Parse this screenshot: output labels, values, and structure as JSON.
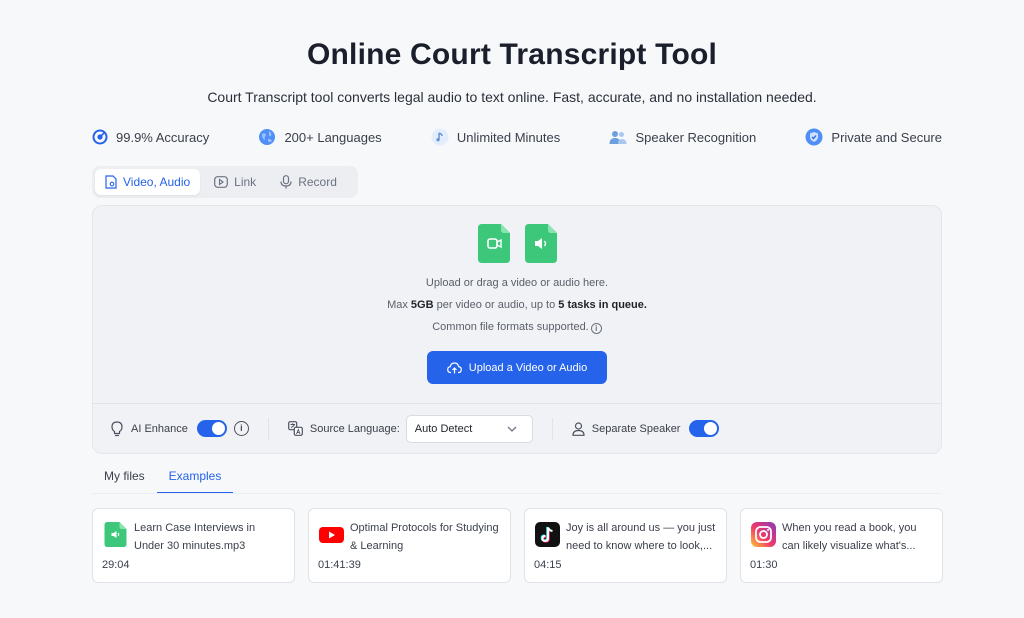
{
  "header": {
    "title": "Online Court Transcript Tool",
    "subtitle": "Court Transcript tool converts legal audio to text online. Fast, accurate, and no installation needed."
  },
  "features": [
    {
      "label": "99.9% Accuracy",
      "icon": "target-icon"
    },
    {
      "label": "200+ Languages",
      "icon": "globe-icon"
    },
    {
      "label": "Unlimited Minutes",
      "icon": "music-note-icon"
    },
    {
      "label": "Speaker Recognition",
      "icon": "users-icon"
    },
    {
      "label": "Private and Secure",
      "icon": "shield-check-icon"
    }
  ],
  "source_tabs": [
    {
      "label": "Video, Audio",
      "active": true
    },
    {
      "label": "Link",
      "active": false
    },
    {
      "label": "Record",
      "active": false
    }
  ],
  "upload": {
    "line1": "Upload or drag a video or audio here.",
    "line2_prefix": "Max ",
    "line2_size": "5GB",
    "line2_mid": " per video or audio, up to ",
    "line2_tasks": "5 tasks in queue.",
    "line3": "Common file formats supported.",
    "button": "Upload a Video or Audio"
  },
  "options": {
    "ai_enhance": "AI Enhance",
    "ai_enhance_on": true,
    "source_language_label": "Source Language:",
    "source_language_value": "Auto Detect",
    "separate_speaker": "Separate Speaker",
    "separate_speaker_on": true
  },
  "file_tabs": [
    {
      "label": "My files",
      "active": false
    },
    {
      "label": "Examples",
      "active": true
    }
  ],
  "examples": [
    {
      "title": "Learn Case Interviews in Under 30 minutes.mp3",
      "duration": "29:04",
      "icon": "audio-file-icon"
    },
    {
      "title": "Optimal Protocols for Studying & Learning",
      "duration": "01:41:39",
      "icon": "youtube-icon"
    },
    {
      "title": "Joy is all around us — you just need to know where to look,...",
      "duration": "04:15",
      "icon": "tiktok-icon"
    },
    {
      "title": "When you read a book, you can likely visualize what's...",
      "duration": "01:30",
      "icon": "instagram-icon"
    }
  ],
  "colors": {
    "accent": "#2563eb",
    "file_green": "#3cc77a",
    "background": "#f7f8fa"
  }
}
